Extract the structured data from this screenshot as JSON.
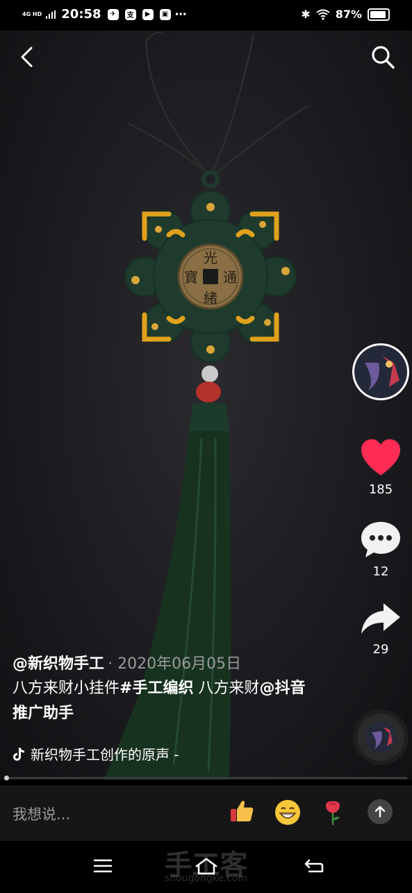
{
  "status": {
    "network": "4G HD",
    "time": "20:58",
    "battery": "87%"
  },
  "actions": {
    "likes": "185",
    "comments": "12",
    "shares": "29"
  },
  "caption": {
    "author": "@新织物手工",
    "date": "2020年06月05日",
    "desc_text": "八方来财小挂件",
    "hashtag": "#手工编织",
    "desc_text2": " 八方来财",
    "mention": "@抖音推广助手"
  },
  "music": {
    "label": "新织物手工创作的原声 -"
  },
  "comment": {
    "placeholder": "我想说..."
  },
  "watermark": {
    "title": "手工客",
    "url": "shougongke.com"
  },
  "colors": {
    "like": "#fe2c55",
    "cord_green": "#1e3a2c",
    "cord_yellow": "#e0a21c"
  }
}
